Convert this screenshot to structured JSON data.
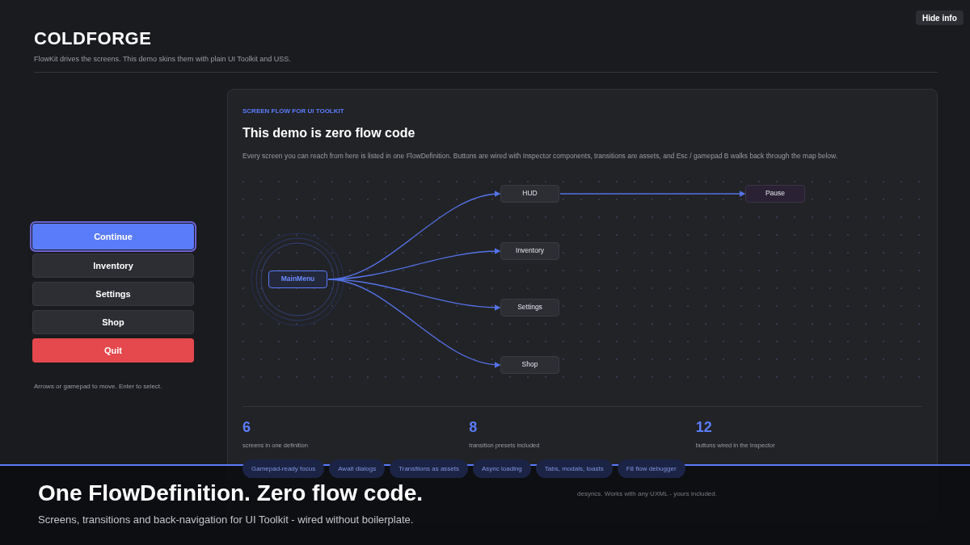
{
  "hide_info_button": "Hide info",
  "header": {
    "title": "COLDFORGE",
    "subtitle": "FlowKit drives the screens. This demo skins them with plain UI Toolkit and USS."
  },
  "menu": {
    "items": [
      {
        "label": "Continue",
        "selected": true,
        "kind": "default"
      },
      {
        "label": "Inventory",
        "selected": false,
        "kind": "default"
      },
      {
        "label": "Settings",
        "selected": false,
        "kind": "default"
      },
      {
        "label": "Shop",
        "selected": false,
        "kind": "default"
      },
      {
        "label": "Quit",
        "selected": false,
        "kind": "danger"
      }
    ],
    "hint": "Arrows or gamepad to move. Enter to select."
  },
  "card": {
    "eyebrow": "SCREEN FLOW FOR UI TOOLKIT",
    "title": "This demo is zero flow code",
    "description": "Every screen you can reach from here is listed in one FlowDefinition. Buttons are wired with Inspector components, transitions are assets, and Esc / gamepad B walks back through the map below.",
    "flow": {
      "label": "MainMenu",
      "kind": "start",
      "children": [
        {
          "label": "HUD",
          "kind": "screen",
          "children": [
            {
              "label": "Pause",
              "kind": "modal"
            }
          ]
        },
        {
          "label": "Inventory",
          "kind": "screen"
        },
        {
          "label": "Settings",
          "kind": "screen"
        },
        {
          "label": "Shop",
          "kind": "screen"
        }
      ]
    },
    "stats": [
      {
        "value": "6",
        "label": "screens in one definition"
      },
      {
        "value": "8",
        "label": "transition presets included"
      },
      {
        "value": "12",
        "label": "buttons wired in the Inspector"
      }
    ],
    "features": [
      "Gamepad-ready focus",
      "Await dialogs",
      "Transitions as assets",
      "Async loading",
      "Tabs, modals, toasts",
      "F8 flow debugger"
    ],
    "footnote": "desyncs. Works with any UXML - yours included."
  },
  "banner": {
    "title": "One FlowDefinition. Zero flow code.",
    "subtitle": "Screens, transitions and back-navigation for UI Toolkit - wired without boilerplate."
  }
}
